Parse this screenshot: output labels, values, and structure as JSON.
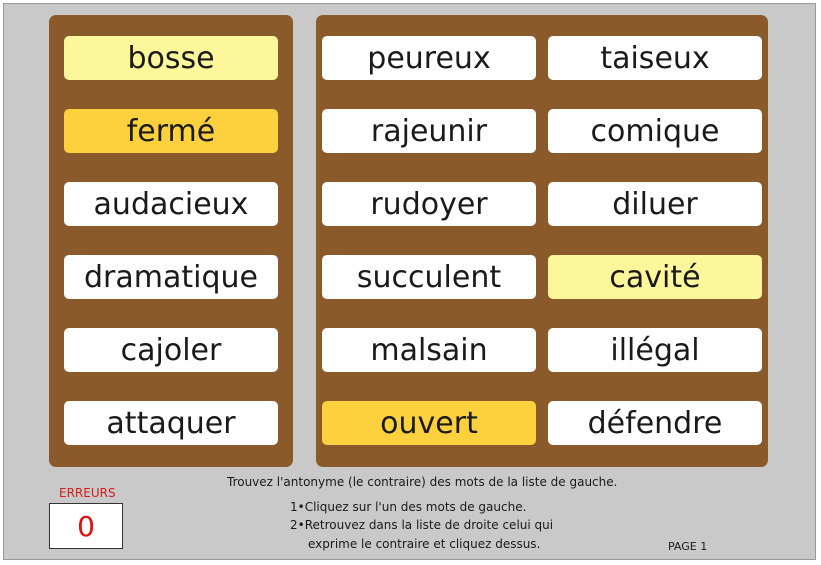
{
  "left_words": [
    {
      "label": "bosse",
      "state": "light"
    },
    {
      "label": "fermé",
      "state": "orange"
    },
    {
      "label": "audacieux",
      "state": "normal"
    },
    {
      "label": "dramatique",
      "state": "normal"
    },
    {
      "label": "cajoler",
      "state": "normal"
    },
    {
      "label": "attaquer",
      "state": "normal"
    }
  ],
  "right_words": [
    {
      "label": "peureux",
      "state": "normal"
    },
    {
      "label": "taiseux",
      "state": "normal"
    },
    {
      "label": "rajeunir",
      "state": "normal"
    },
    {
      "label": "comique",
      "state": "normal"
    },
    {
      "label": "rudoyer",
      "state": "normal"
    },
    {
      "label": "diluer",
      "state": "normal"
    },
    {
      "label": "succulent",
      "state": "normal"
    },
    {
      "label": "cavité",
      "state": "light"
    },
    {
      "label": "malsain",
      "state": "normal"
    },
    {
      "label": "illégal",
      "state": "normal"
    },
    {
      "label": "ouvert",
      "state": "orange"
    },
    {
      "label": "défendre",
      "state": "normal"
    }
  ],
  "instructions": {
    "title": "Trouvez l'antonyme (le contraire) des mots de la liste de gauche.",
    "step1": "1•Cliquez sur l'un des mots de gauche.",
    "step2": "2•Retrouvez dans la liste de droite celui qui",
    "step2b": "exprime le contraire et cliquez dessus."
  },
  "errors": {
    "label": "ERREURS",
    "count": "0"
  },
  "page_label": "PAGE 1",
  "colors": {
    "panel": "#8b5a2b",
    "highlight_light": "#fdf79b",
    "highlight_orange": "#fdd13d",
    "background": "#c9c9c9",
    "error_red": "#e01010"
  }
}
